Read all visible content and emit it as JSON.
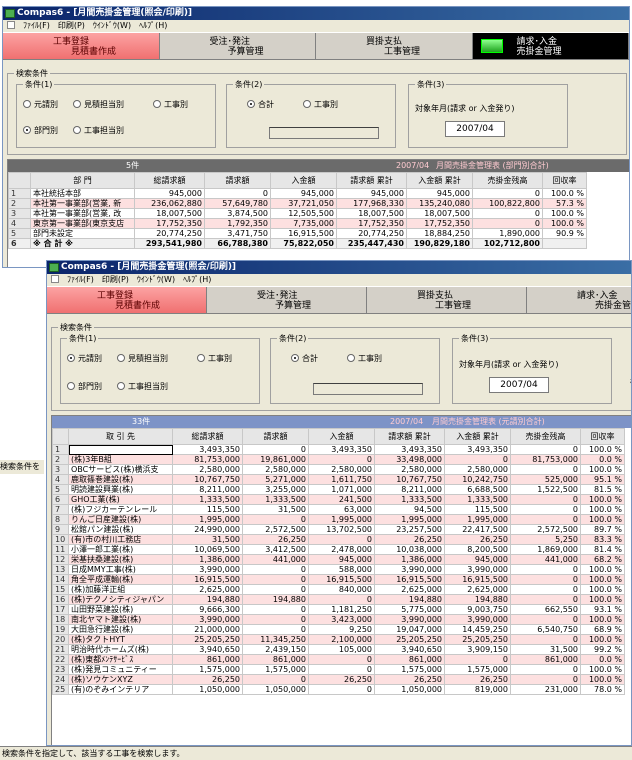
{
  "win1": {
    "title": "Compas6 - [月間売掛金管理(照会/印刷)]",
    "menu": [
      "ﾌｧｲﾙ(F)",
      "印刷(P)",
      "ｳｲﾝﾄﾞｳ(W)",
      "ﾍﾙﾌﾟ(H)"
    ],
    "nav": [
      {
        "l1": "工事登録",
        "l2": "見積書作成"
      },
      {
        "l1": "受注･発注",
        "l2": "予算管理"
      },
      {
        "l1": "買掛支払",
        "l2": "工事管理"
      },
      {
        "l1": "請求･入金",
        "l2": "売掛金管理"
      }
    ],
    "search": {
      "group_label": "検索条件",
      "cond1_label": "条件(1)",
      "cond2_label": "条件(2)",
      "cond3_label": "条件(3)",
      "r_motouke": "元請別",
      "r_mitsumori": "見積担当別",
      "r_kouji": "工事別",
      "r_bumon": "部門別",
      "r_koujitantou": "工事担当別",
      "r_goukei": "合計",
      "r_koujibetsu": "工事別",
      "period_label": "対象年月(請求 or 入金発り)",
      "period_value": "2007/04"
    },
    "grid": {
      "count": "5件",
      "period": "2007/04",
      "title": "月間売掛金管理表 (部門別合計)",
      "headers": [
        "部 門",
        "総請求額",
        "請求額",
        "入金額",
        "請求額 累計",
        "入金額 累計",
        "売掛金残高",
        "回収率"
      ],
      "rows": [
        {
          "i": "1",
          "name": "本社統括本部",
          "v": [
            "945,000",
            "0",
            "945,000",
            "945,000",
            "945,000",
            "0",
            "100.0 %"
          ]
        },
        {
          "i": "2",
          "name": "本社第一事業部(営業, 新",
          "v": [
            "236,062,880",
            "57,649,780",
            "37,721,050",
            "177,968,330",
            "135,240,080",
            "100,822,800",
            "57.3 %"
          ]
        },
        {
          "i": "3",
          "name": "本社第一事業部(営業, 改",
          "v": [
            "18,007,500",
            "3,874,500",
            "12,505,500",
            "18,007,500",
            "18,007,500",
            "0",
            "100.0 %"
          ]
        },
        {
          "i": "4",
          "name": "東京第一事業部(東京支店",
          "v": [
            "17,752,350",
            "1,792,350",
            "7,735,000",
            "17,752,350",
            "17,752,350",
            "0",
            "100.0 %"
          ]
        },
        {
          "i": "5",
          "name": "部門未設定",
          "v": [
            "20,774,250",
            "3,471,750",
            "16,915,500",
            "20,774,250",
            "18,884,250",
            "1,890,000",
            "90.9 %"
          ]
        },
        {
          "i": "6",
          "name": "※ 合 計 ※",
          "v": [
            "293,541,980",
            "66,788,380",
            "75,822,050",
            "235,447,430",
            "190,829,180",
            "102,712,800",
            ""
          ]
        }
      ]
    },
    "side_stub": "検索条件を"
  },
  "win2": {
    "title": "Compas6 - [月間売掛金管理(照会/印刷)]",
    "menu": [
      "ﾌｧｲﾙ(F)",
      "印刷(P)",
      "ｳｲﾝﾄﾞｳ(W)",
      "ﾍﾙﾌﾟ(H)"
    ],
    "nav": [
      {
        "l1": "工事登録",
        "l2": "見積書作成"
      },
      {
        "l1": "受注･発注",
        "l2": "予算管理"
      },
      {
        "l1": "買掛支払",
        "l2": "工事管理"
      },
      {
        "l1": "請求･入金",
        "l2": "売掛金管理"
      }
    ],
    "search": {
      "group_label": "検索条件",
      "cond1_label": "条件(1)",
      "cond2_label": "条件(2)",
      "cond3_label": "条件(3)",
      "r_motouke": "元請別",
      "r_mitsumori": "見積担当別",
      "r_kouji": "工事別",
      "r_bumon": "部門別",
      "r_koujitantou": "工事担当別",
      "r_goukei": "合計",
      "r_koujibetsu": "工事別",
      "period_label": "対象年月(請求 or 入金発り)",
      "period_value": "2007/04",
      "trailing": "検"
    },
    "grid": {
      "count": "33件",
      "period": "2007/04",
      "title": "月間売掛金管理表 (元請別合計)",
      "headers": [
        "取 引 先",
        "総請求額",
        "請求額",
        "入金額",
        "請求額 累計",
        "入金額 累計",
        "売掛金残高",
        "回収率"
      ],
      "rows": [
        {
          "i": "1",
          "name": "",
          "v": [
            "3,493,350",
            "0",
            "3,493,350",
            "3,493,350",
            "3,493,350",
            "0",
            "100.0 %"
          ]
        },
        {
          "i": "2",
          "name": "(株)3年B組",
          "v": [
            "81,753,000",
            "19,861,000",
            "0",
            "33,498,000",
            "0",
            "81,753,000",
            "0.0 %"
          ]
        },
        {
          "i": "3",
          "name": "OBCサービス(株)横浜支",
          "v": [
            "2,580,000",
            "2,580,000",
            "2,580,000",
            "2,580,000",
            "2,580,000",
            "0",
            "100.0 %"
          ]
        },
        {
          "i": "4",
          "name": "鹿取篠巻建設(株)",
          "v": [
            "10,767,750",
            "5,271,000",
            "1,611,750",
            "10,767,750",
            "10,242,750",
            "525,000",
            "95.1 %"
          ]
        },
        {
          "i": "5",
          "name": "明読建設興業(株)",
          "v": [
            "8,211,000",
            "3,255,000",
            "1,071,000",
            "8,211,000",
            "6,688,500",
            "1,522,500",
            "81.5 %"
          ]
        },
        {
          "i": "6",
          "name": "GHO工業(株)",
          "v": [
            "1,333,500",
            "1,333,500",
            "241,500",
            "1,333,500",
            "1,333,500",
            "0",
            "100.0 %"
          ]
        },
        {
          "i": "7",
          "name": "(株)フジカーテンレール",
          "v": [
            "115,500",
            "31,500",
            "63,000",
            "94,500",
            "115,500",
            "0",
            "100.0 %"
          ]
        },
        {
          "i": "8",
          "name": "りんご日産建設(株)",
          "v": [
            "1,995,000",
            "0",
            "1,995,000",
            "1,995,000",
            "1,995,000",
            "0",
            "100.0 %"
          ]
        },
        {
          "i": "9",
          "name": "松館パン建設(株)",
          "v": [
            "24,990,000",
            "2,572,500",
            "13,702,500",
            "23,257,500",
            "22,417,500",
            "2,572,500",
            "89.7 %"
          ]
        },
        {
          "i": "10",
          "name": "(有)市の村川工務店",
          "v": [
            "31,500",
            "26,250",
            "0",
            "26,250",
            "26,250",
            "5,250",
            "83.3 %"
          ]
        },
        {
          "i": "11",
          "name": "小澤一郎工業(株)",
          "v": [
            "10,069,500",
            "3,412,500",
            "2,478,000",
            "10,038,000",
            "8,200,500",
            "1,869,000",
            "81.4 %"
          ]
        },
        {
          "i": "12",
          "name": "栄基扶桑建設(株)",
          "v": [
            "1,386,000",
            "441,000",
            "945,000",
            "1,386,000",
            "945,000",
            "441,000",
            "68.2 %"
          ]
        },
        {
          "i": "13",
          "name": "日成MMY工事(株)",
          "v": [
            "3,990,000",
            "0",
            "588,000",
            "3,990,000",
            "3,990,000",
            "0",
            "100.0 %"
          ]
        },
        {
          "i": "14",
          "name": "角全平成運輸(株)",
          "v": [
            "16,915,500",
            "0",
            "16,915,500",
            "16,915,500",
            "16,915,500",
            "0",
            "100.0 %"
          ]
        },
        {
          "i": "15",
          "name": "(株)加藤洋正組",
          "v": [
            "2,625,000",
            "0",
            "840,000",
            "2,625,000",
            "2,625,000",
            "0",
            "100.0 %"
          ]
        },
        {
          "i": "16",
          "name": "(株)テクノシティジャパン",
          "v": [
            "194,880",
            "194,880",
            "0",
            "194,880",
            "194,880",
            "0",
            "100.0 %"
          ]
        },
        {
          "i": "17",
          "name": "山田野菜建設(株)",
          "v": [
            "9,666,300",
            "0",
            "1,181,250",
            "5,775,000",
            "9,003,750",
            "662,550",
            "93.1 %"
          ]
        },
        {
          "i": "18",
          "name": "南北ヤマト建設(株)",
          "v": [
            "3,990,000",
            "0",
            "3,423,000",
            "3,990,000",
            "3,990,000",
            "0",
            "100.0 %"
          ]
        },
        {
          "i": "19",
          "name": "大田急行建設(株)",
          "v": [
            "21,000,000",
            "0",
            "9,250",
            "19,047,000",
            "14,459,250",
            "6,540,750",
            "68.9 %"
          ]
        },
        {
          "i": "20",
          "name": "(株)タクトHYT",
          "v": [
            "25,205,250",
            "11,345,250",
            "2,100,000",
            "25,205,250",
            "25,205,250",
            "0",
            "100.0 %"
          ]
        },
        {
          "i": "21",
          "name": "明治時代ホームズ(株)",
          "v": [
            "3,940,650",
            "2,439,150",
            "105,000",
            "3,940,650",
            "3,909,150",
            "31,500",
            "99.2 %"
          ]
        },
        {
          "i": "22",
          "name": "(株)東都ﾒﾝﾃｻｰﾋﾞｽ",
          "v": [
            "861,000",
            "861,000",
            "0",
            "861,000",
            "0",
            "861,000",
            "0.0 %"
          ]
        },
        {
          "i": "23",
          "name": "(株)発見コミュニティー",
          "v": [
            "1,575,000",
            "1,575,000",
            "0",
            "1,575,000",
            "1,575,000",
            "0",
            "100.0 %"
          ]
        },
        {
          "i": "24",
          "name": "(株)ソウケンXYZ",
          "v": [
            "26,250",
            "0",
            "26,250",
            "26,250",
            "26,250",
            "0",
            "100.0 %"
          ]
        },
        {
          "i": "25",
          "name": "(有)のぞみインテリア",
          "v": [
            "1,050,000",
            "1,050,000",
            "0",
            "1,050,000",
            "819,000",
            "231,000",
            "78.0 %"
          ]
        }
      ]
    }
  },
  "status_text": "検索条件を指定して、該当する工事を検索します。"
}
